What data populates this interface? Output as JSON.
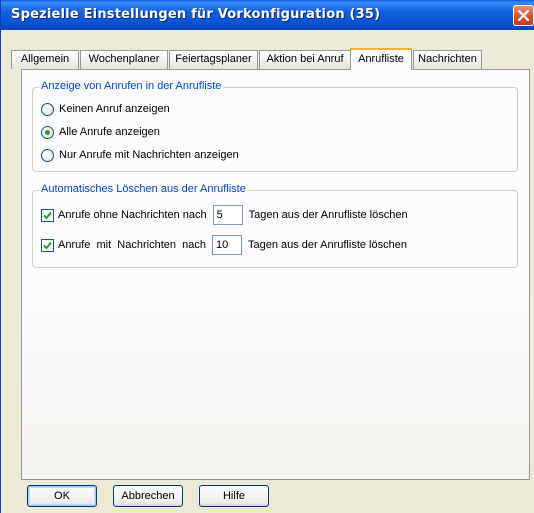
{
  "window": {
    "title": "Spezielle Einstellungen für Vorkonfiguration (35)"
  },
  "tabs": [
    {
      "label": "Allgemein"
    },
    {
      "label": "Wochenplaner"
    },
    {
      "label": "Feiertagsplaner"
    },
    {
      "label": "Aktion bei Anruf"
    },
    {
      "label": "Anrufliste",
      "active": true
    },
    {
      "label": "Nachrichten"
    }
  ],
  "display_group": {
    "legend": "Anzeige von Anrufen in der Anrufliste",
    "options": [
      {
        "label": "Keinen Anruf anzeigen",
        "selected": false
      },
      {
        "label": "Alle Anrufe anzeigen",
        "selected": true
      },
      {
        "label": "Nur Anrufe mit Nachrichten anzeigen",
        "selected": false
      }
    ]
  },
  "delete_group": {
    "legend": "Automatisches Löschen aus der Anrufliste",
    "row1": {
      "checked": true,
      "label": "Anrufe ohne Nachrichten nach",
      "days": "5",
      "suffix": "Tagen aus der Anrufliste löschen"
    },
    "row2": {
      "checked": true,
      "label": "Anrufe  mit  Nachrichten  nach",
      "days": "10",
      "suffix": "Tagen aus der Anrufliste löschen"
    }
  },
  "buttons": {
    "ok": "OK",
    "cancel": "Abbrechen",
    "help": "Hilfe"
  },
  "colors": {
    "title_bar": "#0a4fce",
    "group_legend": "#0046d5",
    "active_tab_accent": "#f8b33a",
    "check_mark": "#21a121"
  }
}
